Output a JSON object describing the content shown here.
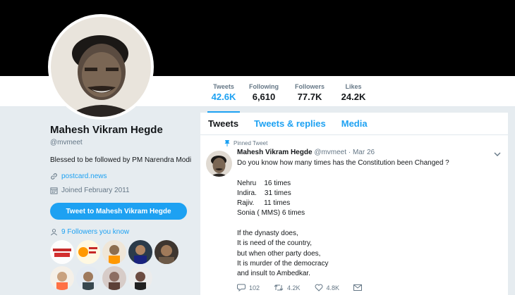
{
  "profile": {
    "name": "Mahesh Vikram Hegde",
    "handle": "@mvmeet",
    "bio": "Blessed to be followed by PM Narendra Modi",
    "website": "postcard.news",
    "joined": "Joined February 2011",
    "follow_button": "Tweet to Mahesh Vikram Hegde",
    "followers_you_know": "9 Followers you know"
  },
  "stats": [
    {
      "label": "Tweets",
      "value": "42.6K"
    },
    {
      "label": "Following",
      "value": "6,610"
    },
    {
      "label": "Followers",
      "value": "77.7K"
    },
    {
      "label": "Likes",
      "value": "24.2K"
    }
  ],
  "tabs": [
    "Tweets",
    "Tweets & replies",
    "Media"
  ],
  "tweet": {
    "pinned_label": "Pinned Tweet",
    "author": "Mahesh Vikram Hegde",
    "handle": "@mvmeet",
    "date": "Mar 26",
    "body": "Do you know how many times has the Constitution been Changed ?\n\nNehru    16 times\nIndira.    31 times\nRajiv.     11 times\nSonia ( MMS) 6 times\n\nIf the dynasty does,\nIt is need of the country,\nbut when other party does,\nIt is murder of the democracy\nand insult to Ambedkar.",
    "replies": "102",
    "retweets": "4.2K",
    "likes": "4.8K"
  },
  "colors": {
    "accent": "#1da1f2",
    "banner": "#000000",
    "page_bg": "#e6ecf0"
  },
  "icons": [
    "link-icon",
    "calendar-icon",
    "people-icon",
    "pin-icon",
    "chevron-down-icon",
    "reply-icon",
    "retweet-icon",
    "heart-icon",
    "message-icon"
  ]
}
